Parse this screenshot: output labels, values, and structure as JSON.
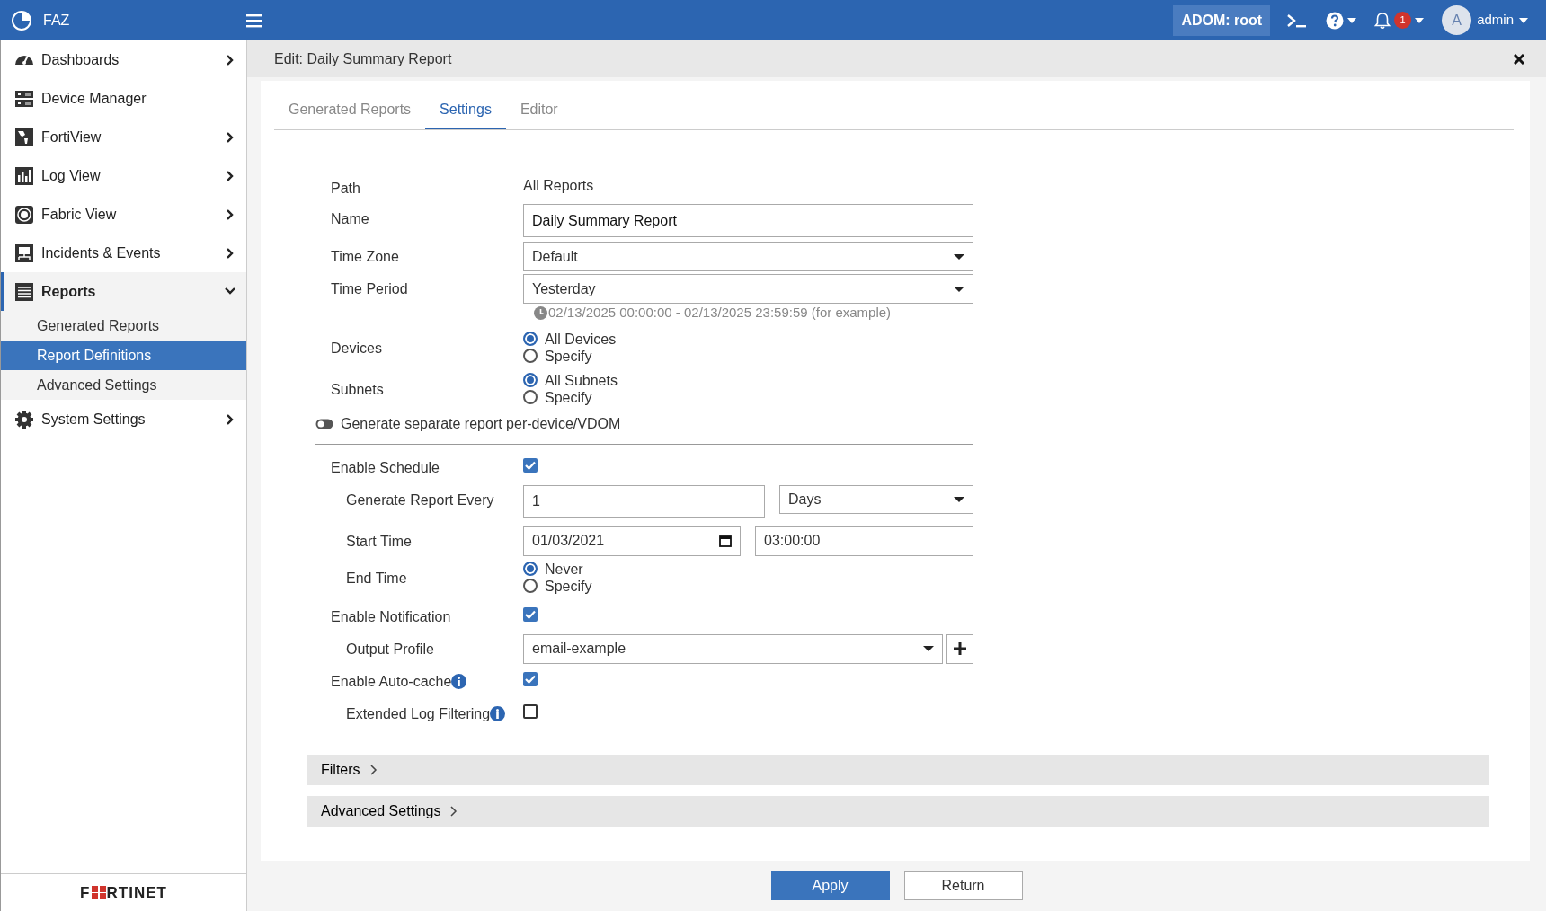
{
  "header": {
    "app_name": "FAZ",
    "adom": "ADOM: root",
    "notification_count": "1",
    "avatar_initial": "A",
    "user": "admin"
  },
  "sidebar": {
    "items": [
      {
        "label": "Dashboards",
        "kind": "group",
        "expanded": false,
        "selected": false
      },
      {
        "label": "Device Manager",
        "kind": "link",
        "selected": false
      },
      {
        "label": "FortiView",
        "kind": "group",
        "expanded": false,
        "selected": false
      },
      {
        "label": "Log View",
        "kind": "group",
        "expanded": false,
        "selected": false
      },
      {
        "label": "Fabric View",
        "kind": "group",
        "expanded": false,
        "selected": false
      },
      {
        "label": "Incidents & Events",
        "kind": "group",
        "expanded": false,
        "selected": false
      },
      {
        "label": "Reports",
        "kind": "group",
        "expanded": true,
        "selected": true,
        "children": [
          {
            "label": "Generated Reports",
            "selected": false
          },
          {
            "label": "Report Definitions",
            "selected": true
          },
          {
            "label": "Advanced Settings",
            "selected": false
          }
        ]
      },
      {
        "label": "System Settings",
        "kind": "group",
        "expanded": false,
        "selected": false
      }
    ],
    "footer_logo": [
      "F",
      "RTINET"
    ]
  },
  "page_title": "Edit: Daily Summary Report",
  "tabs": [
    {
      "label": "Generated Reports",
      "selected": false
    },
    {
      "label": "Settings",
      "selected": true
    },
    {
      "label": "Editor",
      "selected": false
    }
  ],
  "form": [
    {
      "label": "Path",
      "kind": "text",
      "value": "All Reports"
    },
    {
      "label": "Name",
      "kind": "input",
      "value": "Daily Summary Report"
    },
    {
      "label": "Time Zone",
      "kind": "select",
      "value": "Default"
    },
    {
      "label": "Time Period",
      "kind": "select",
      "value": "Yesterday",
      "hint": "02/13/2025 00:00:00 - 02/13/2025 23:59:59 (for example)"
    },
    {
      "label": "Devices",
      "kind": "radio",
      "options": [
        {
          "label": "All Devices",
          "selected": true
        },
        {
          "label": "Specify",
          "selected": false
        }
      ]
    },
    {
      "label": "Subnets",
      "kind": "radio",
      "options": [
        {
          "label": "All Subnets",
          "selected": true
        },
        {
          "label": "Specify",
          "selected": false
        }
      ]
    },
    {
      "label": "Generate separate report per-device/VDOM",
      "kind": "toggle",
      "on": false
    },
    {
      "label": "Enable Schedule",
      "kind": "checkbox",
      "checked": true,
      "children": [
        {
          "label": "Generate Report Every",
          "kind": "input_select",
          "value": "1",
          "unit": "Days"
        },
        {
          "label": "Start Time",
          "kind": "datetime",
          "date": "01/03/2021",
          "time": "03:00:00"
        },
        {
          "label": "End Time",
          "kind": "radio",
          "options": [
            {
              "label": "Never",
              "selected": true
            },
            {
              "label": "Specify",
              "selected": false
            }
          ]
        }
      ]
    },
    {
      "label": "Enable Notification",
      "kind": "checkbox",
      "checked": true,
      "children": [
        {
          "label": "Output Profile",
          "kind": "select_add",
          "value": "email-example"
        }
      ]
    },
    {
      "label": "Enable Auto-cache",
      "kind": "checkbox",
      "checked": true,
      "info": true,
      "children": [
        {
          "label": "Extended Log Filtering",
          "kind": "checkbox",
          "checked": false,
          "info": true
        }
      ]
    }
  ],
  "sections": [
    {
      "label": "Filters",
      "expanded": false
    },
    {
      "label": "Advanced Settings",
      "expanded": false
    }
  ],
  "buttons": [
    {
      "label": "Apply",
      "kind": "primary"
    },
    {
      "label": "Return",
      "kind": "secondary"
    }
  ]
}
